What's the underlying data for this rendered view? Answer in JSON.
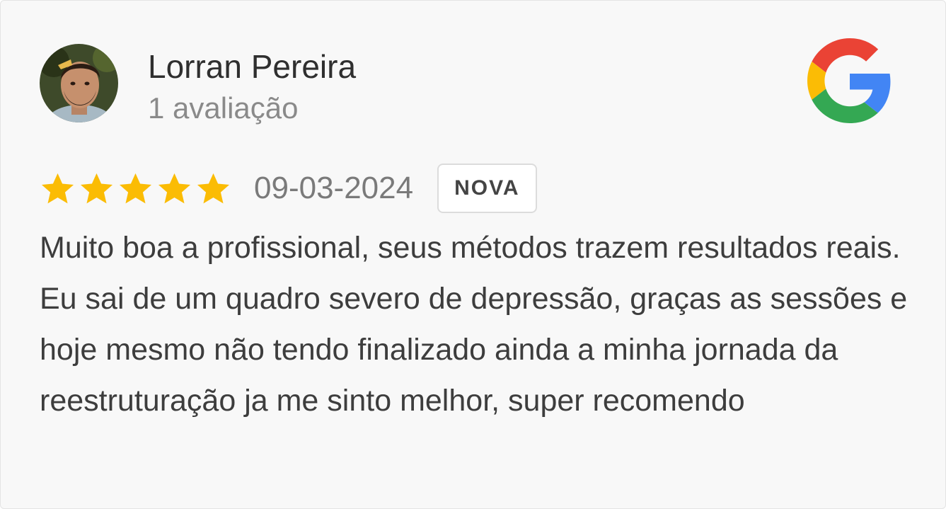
{
  "review": {
    "author_name": "Lorran Pereira",
    "author_reviews_count": "1 avaliação",
    "rating": 5,
    "rating_max": 5,
    "date": "09-03-2024",
    "badge": "NOVA",
    "text": "Muito boa a profissional, seus métodos trazem resultados reais. Eu sai de um quadro severo de depressão, graças as sessões e hoje mesmo não tendo finalizado ainda a minha jornada da reestruturação ja me sinto melhor, super recomendo"
  },
  "icons": {
    "brand": "google-g-icon",
    "star": "star-icon",
    "avatar": "user-avatar"
  },
  "colors": {
    "star": "#fbbc04",
    "google_blue": "#4285f4",
    "google_red": "#ea4335",
    "google_yellow": "#fbbc05",
    "google_green": "#34a853"
  }
}
